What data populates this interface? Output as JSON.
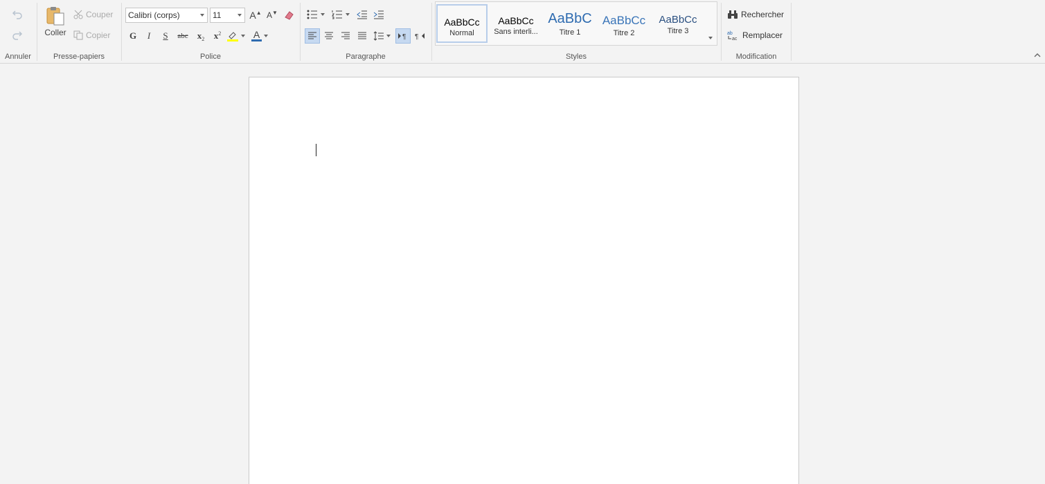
{
  "ribbon": {
    "undo_group": {
      "label": "Annuler"
    },
    "clipboard": {
      "label": "Presse-papiers",
      "paste_label": "Coller",
      "cut_label": "Couper",
      "copy_label": "Copier"
    },
    "font": {
      "label": "Police",
      "family": "Calibri (corps)",
      "size": "11",
      "bold_glyph": "G",
      "italic_glyph": "I",
      "underline_glyph": "S",
      "strike_glyph": "abc",
      "subscript_glyph": "x",
      "superscript_glyph": "x",
      "font_color_glyph": "A",
      "grow_glyph": "A",
      "shrink_glyph": "A"
    },
    "paragraph": {
      "label": "Paragraphe"
    },
    "styles": {
      "label": "Styles",
      "items": [
        {
          "sample": "AaBbCc",
          "name": "Normal",
          "color": "#000000"
        },
        {
          "sample": "AaBbCc",
          "name": "Sans interli...",
          "color": "#000000"
        },
        {
          "sample": "AaBbC",
          "name": "Titre 1",
          "color": "#2e6bb0"
        },
        {
          "sample": "AaBbCc",
          "name": "Titre 2",
          "color": "#3a75b8"
        },
        {
          "sample": "AaBbCc",
          "name": "Titre 3",
          "color": "#2a4f80"
        }
      ]
    },
    "editing": {
      "label": "Modification",
      "find_label": "Rechercher",
      "replace_label": "Remplacer"
    }
  },
  "colors": {
    "highlight": "#ffff00",
    "font_color": "#2e6bb0",
    "active_blue": "#c6d9f1"
  }
}
